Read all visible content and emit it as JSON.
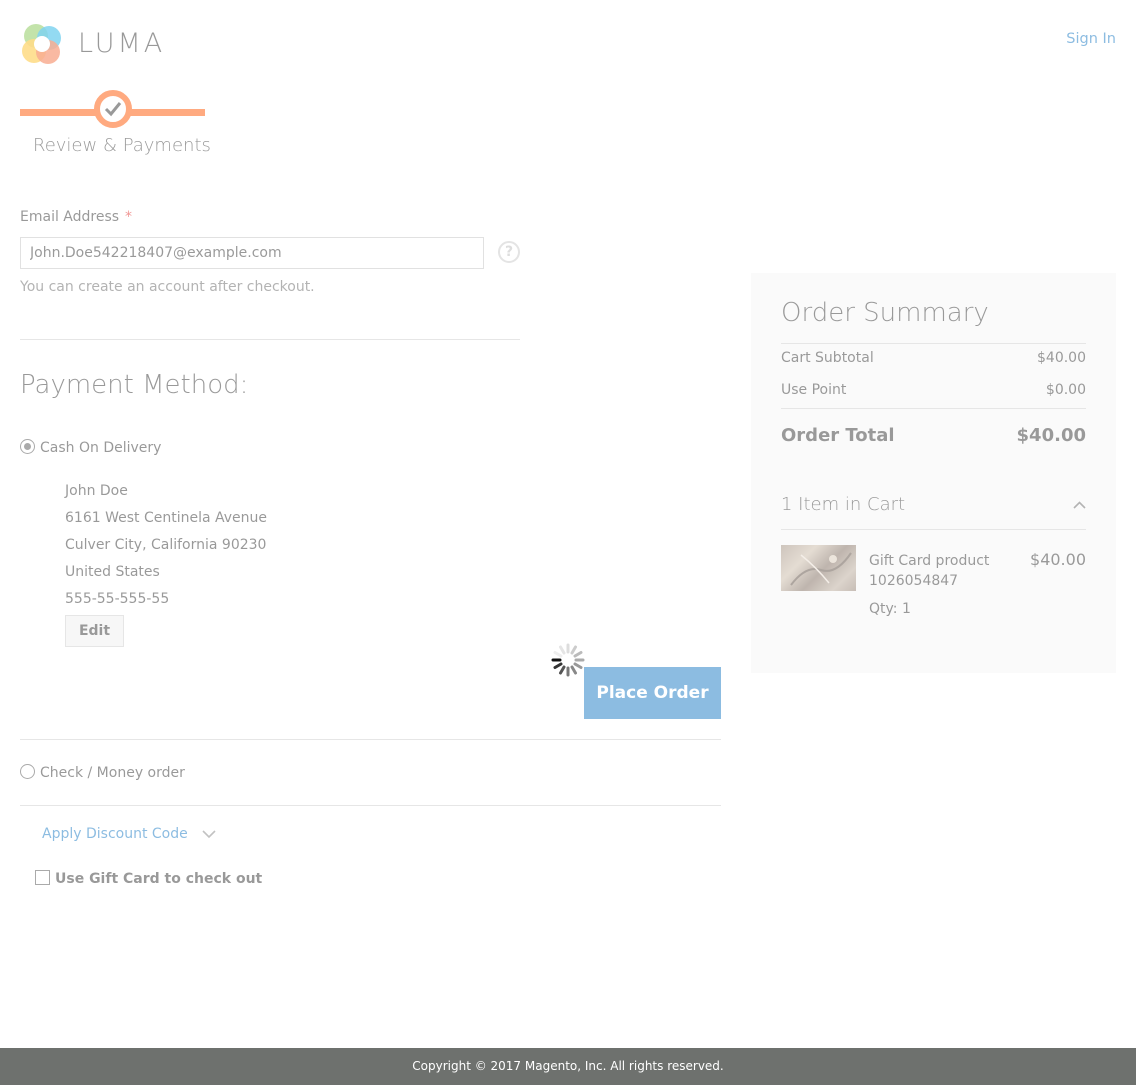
{
  "header": {
    "logo_text": "LUMA",
    "sign_in": "Sign In"
  },
  "progress": {
    "step_label": "Review & Payments"
  },
  "email": {
    "label": "Email Address",
    "required_mark": "*",
    "value": "John.Doe542218407@example.com",
    "help_icon": "?",
    "note": "You can create an account after checkout."
  },
  "payment": {
    "title": "Payment Method:",
    "methods": [
      {
        "label": "Cash On Delivery",
        "selected": true
      },
      {
        "label": "Check / Money order",
        "selected": false
      }
    ],
    "address": {
      "name": "John Doe",
      "street": "6161 West Centinela Avenue",
      "city_line": "Culver City, California 90230",
      "country": "United States",
      "phone": "555-55-555-55"
    },
    "edit_label": "Edit",
    "place_order_label": "Place Order",
    "discount_label": "Apply Discount Code",
    "gift_card_label": "Use Gift Card to check out",
    "gift_card_checked": false
  },
  "summary": {
    "title": "Order Summary",
    "rows": [
      {
        "label": "Cart Subtotal",
        "value": "$40.00"
      },
      {
        "label": "Use Point",
        "value": "$0.00"
      }
    ],
    "total_label": "Order Total",
    "total_value": "$40.00",
    "items_heading": "1 Item in Cart",
    "item": {
      "name": "Gift Card product 1026054847",
      "price": "$40.00",
      "qty": "Qty: 1"
    }
  },
  "footer": {
    "copyright": "Copyright © 2017 Magento, Inc. All rights reserved."
  },
  "colors": {
    "accent": "#ff5501",
    "link": "#1979c3",
    "footer_bg": "#6e716e"
  },
  "icons": [
    "luma-logo-icon",
    "checkmark-icon",
    "help-icon",
    "chevron-down-icon",
    "chevron-up-icon",
    "loading-spinner-icon"
  ]
}
